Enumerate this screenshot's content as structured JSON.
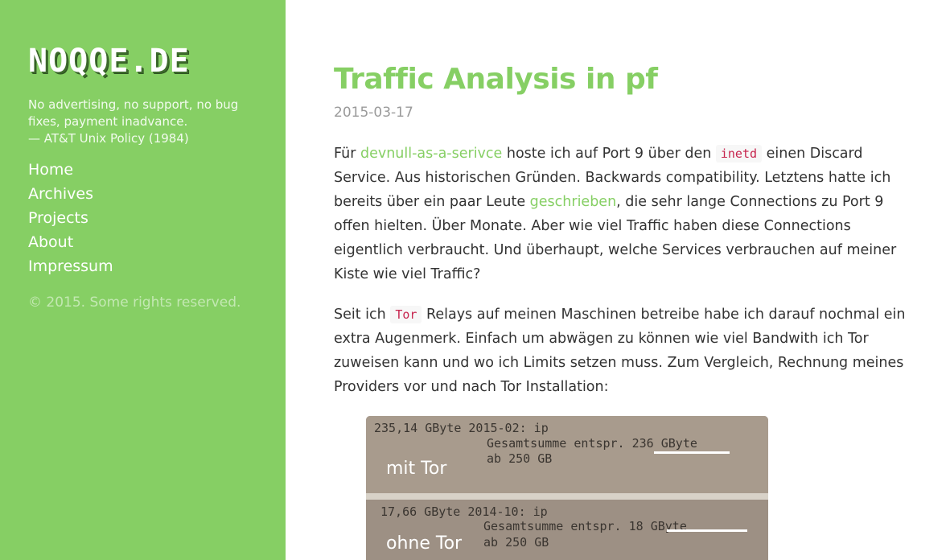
{
  "sidebar": {
    "logo": "NOQQE.DE",
    "tagline": {
      "line1": "No advertising, no support, no bug",
      "line2": "fixes, payment inadvance.",
      "line3": "— AT&T Unix Policy (1984)"
    },
    "nav": [
      "Home",
      "Archives",
      "Projects",
      "About",
      "Impressum"
    ],
    "copyright": "© 2015. Some rights reserved."
  },
  "post": {
    "title": "Traffic Analysis in pf",
    "date": "2015-03-17",
    "p1": {
      "t1": "Für ",
      "link1": "devnull-as-a-serivce",
      "t2": " hoste ich auf Port 9 über den ",
      "code1": "inetd",
      "t3": " einen Discard Service. Aus historischen Gründen. Backwards compatibility. Letztens hatte ich bereits über ein paar Leute ",
      "link2": "geschrieben",
      "t4": ", die sehr lange Connections zu Port 9 offen hielten. Über Monate. Aber wie viel Traffic haben diese Connections eigentlich verbraucht. Und überhaupt, welche Services verbrauchen auf meiner Kiste wie viel Traffic?"
    },
    "p2": {
      "t1": "Seit ich ",
      "code1": "Tor",
      "t2": " Relays auf meinen Maschinen betreibe habe ich darauf nochmal ein extra Augenmerk. Einfach um abwägen zu können wie viel Bandwith ich Tor zuweisen kann und wo ich Limits setzen muss. Zum Vergleich, Rechnung meines Providers vor und nach Tor Installation:"
    }
  },
  "photo": {
    "top_line1": "235,14 GByte 2015-02: ip",
    "top_line2": "Gesamtsumme entspr. 236 GByte",
    "top_line3": "ab 250 GB",
    "top_label": "mit Tor",
    "bottom_line1": "17,66 GByte 2014-10: ip",
    "bottom_line2": "Gesamtsumme entspr. 18 GByte",
    "bottom_line3": "ab 250 GB",
    "bottom_label": "ohne Tor"
  },
  "colors": {
    "accent": "#86cf64",
    "code": "#c7254e"
  }
}
